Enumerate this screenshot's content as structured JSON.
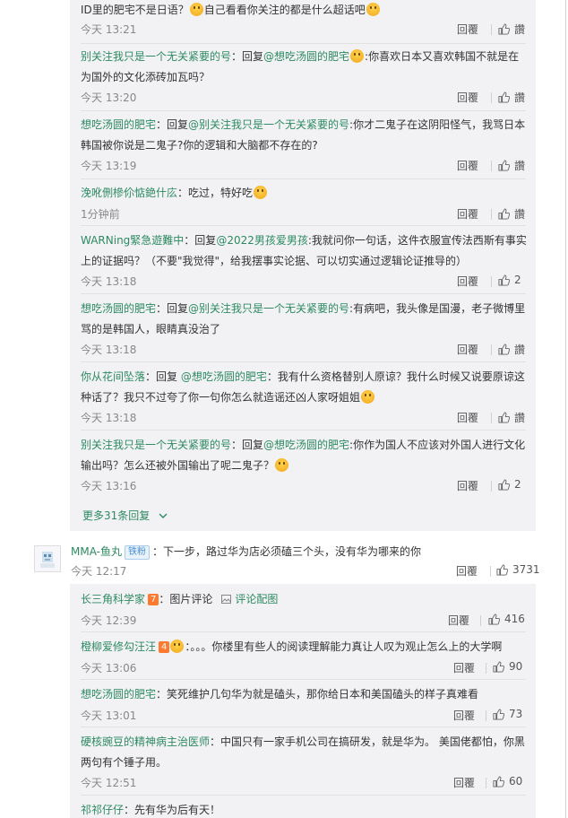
{
  "thread": {
    "replies": [
      {
        "text_a": "ID里的肥宅不是日语？",
        "text_b": "自己看看你关注的都是什么超话吧",
        "time": "今天 13:21",
        "reply": "回覆",
        "like": "讚"
      },
      {
        "user": "别关注我只是一个无关紧要的号",
        "sep": "：回复",
        "mention": "@想吃汤圆的肥宅",
        "text": ":你喜欢日本又喜欢韩国不就是在为国外的文化添砖加瓦吗？",
        "time": "今天 13:20",
        "reply": "回覆",
        "like": "讚"
      },
      {
        "user": "想吃汤圆的肥宅",
        "sep": "：回复",
        "mention": "@别关注我只是一个无关紧要的号",
        "text": ":你才二鬼子在这阴阳怪气，我骂日本韩国被你说是二鬼子?你的逻辑和大脑都不存在的?",
        "time": "今天 13:19",
        "reply": "回覆",
        "like": "讚"
      },
      {
        "user": "浼吪侀槮伱惦銫什庅",
        "text": "：吃过，特好吃",
        "time": "1分钟前",
        "reply": "回覆",
        "like": "讚"
      },
      {
        "user": "WARNing緊急遊難中",
        "sep": "：回复",
        "mention": "@2022男孩爱男孩",
        "text": ":我就问你一句话，这件衣服宣传法西斯有事实上的证据吗？（不要\"我觉得\"，给我摆事实论据、可以切实通过逻辑论证推导的）",
        "time": "今天 13:18",
        "reply": "回覆",
        "like": "2"
      },
      {
        "user": "想吃汤圆的肥宅",
        "sep": "：回复",
        "mention": "@别关注我只是一个无关紧要的号",
        "text": ":有病吧，我头像是国漫，老子微博里骂的是韩国人，眼睛真没治了",
        "time": "今天 13:18",
        "reply": "回覆",
        "like": "讚"
      },
      {
        "user": "你从花间坠落",
        "sep": "：回复 ",
        "mention": "@想吃汤圆的肥宅",
        "text": "：我有什么资格替别人原谅？我什么时候又说要原谅这种话了？我只不过夸了你一句你怎么就造谣还凶人家呀姐姐",
        "time": "今天 13:18",
        "reply": "回覆",
        "like": "讚"
      },
      {
        "user": "别关注我只是一个无关紧要的号",
        "sep": "：回复",
        "mention": "@想吃汤圆的肥宅",
        "text": ":你作为国人不应该对外国人进行文化输出吗？怎么还被外国输出了呢二鬼子？",
        "time": "今天 13:16",
        "reply": "回覆",
        "like": "2"
      }
    ],
    "more_label": "更多31条回复",
    "more_icon": "chevron-down-icon"
  },
  "top_comment": {
    "user": "MMA-鱼丸",
    "badge": "铁粉",
    "text": "：下一步，路过华为店必须磕三个头，没有华为哪来的你",
    "time": "今天 12:17",
    "reply": "回覆",
    "like": "3731"
  },
  "sub_replies": [
    {
      "user": "长三角科学家",
      "fan": "7",
      "text": "：图片评论",
      "pic_label": "评论配图",
      "time": "今天 12:39",
      "reply": "回覆",
      "like": "416"
    },
    {
      "user": "橙柳爱修勾汪汪",
      "fan": "4",
      "text": "：。。。你楼里有些人的阅读理解能力真让人叹为观止怎么上的大学啊",
      "time": "今天 13:06",
      "reply": "回覆",
      "like": "90"
    },
    {
      "user": "想吃汤圆的肥宅",
      "text": "：笑死维护几句华为就是磕头，那你给日本和美国磕头的样子真难看",
      "time": "今天 13:01",
      "reply": "回覆",
      "like": "73"
    },
    {
      "user": "硬核豌豆的精神病主治医师",
      "text": "：中国只有一家手机公司在搞研发，就是华为。 美国佬都怕，你黑两句有个锤子用。",
      "time": "今天 12:51",
      "reply": "回覆",
      "like": "60"
    },
    {
      "user": "祁祁仔仔",
      "text": "：先有华为后有天！"
    }
  ],
  "colors": {
    "accent": "#2d8a62",
    "panel": "#f2f2f5",
    "badge": "#4a8fd3"
  }
}
